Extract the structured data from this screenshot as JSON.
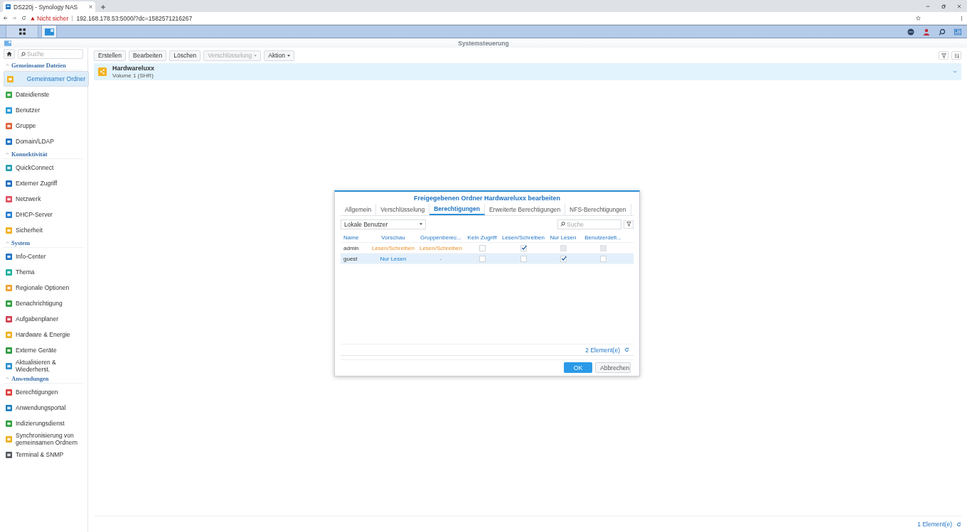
{
  "browser": {
    "tab_title": "DS220j - Synology NAS",
    "security": "Nicht sicher",
    "url": "192.168.178.53:5000/?dc=1582571216267"
  },
  "window": {
    "title": "Systemsteuerung"
  },
  "sidebar": {
    "search": {
      "placeholder": "Suche"
    },
    "sections": [
      {
        "title": "Gemeinsame Dateien",
        "items": [
          {
            "label": "Gemeinsamer Ordner",
            "selected": true
          },
          {
            "label": "Dateidienste",
            "selected": false
          },
          {
            "label": "Benutzer",
            "selected": false
          },
          {
            "label": "Gruppe",
            "selected": false
          },
          {
            "label": "Domain/LDAP",
            "selected": false
          }
        ]
      },
      {
        "title": "Konnektivität",
        "items": [
          {
            "label": "QuickConnect",
            "selected": false
          },
          {
            "label": "Externer Zugriff",
            "selected": false
          },
          {
            "label": "Netzwerk",
            "selected": false
          },
          {
            "label": "DHCP-Server",
            "selected": false
          },
          {
            "label": "Sicherheit",
            "selected": false
          }
        ]
      },
      {
        "title": "System",
        "items": [
          {
            "label": "Info-Center",
            "selected": false
          },
          {
            "label": "Thema",
            "selected": false
          },
          {
            "label": "Regionale Optionen",
            "selected": false
          },
          {
            "label": "Benachrichtigung",
            "selected": false
          },
          {
            "label": "Aufgabenplaner",
            "selected": false
          },
          {
            "label": "Hardware & Energie",
            "selected": false
          },
          {
            "label": "Externe Geräte",
            "selected": false
          },
          {
            "label": "Aktualisieren & Wiederherst.",
            "selected": false
          }
        ]
      },
      {
        "title": "Anwendungen",
        "items": [
          {
            "label": "Berechtigungen",
            "selected": false
          },
          {
            "label": "Anwendungsportal",
            "selected": false
          },
          {
            "label": "Indizierungsdienst",
            "selected": false
          },
          {
            "label": "Synchronisierung von gemeinsamen Ordnern",
            "selected": false
          },
          {
            "label": "Terminal & SNMP",
            "selected": false
          }
        ]
      }
    ]
  },
  "toolbar": [
    {
      "label": "Erstellen",
      "dropdown": false,
      "disabled": false
    },
    {
      "label": "Bearbeiten",
      "dropdown": false,
      "disabled": false
    },
    {
      "label": "Löschen",
      "dropdown": false,
      "disabled": false
    },
    {
      "label": "Verschlüsselung",
      "dropdown": true,
      "disabled": true
    },
    {
      "label": "Aktion",
      "dropdown": true,
      "disabled": false
    }
  ],
  "folders": [
    {
      "name": "Hardwareluxx",
      "volume": "Volume 1 (SHR)",
      "selected": true
    }
  ],
  "status": "1 Element(e)",
  "dialog": {
    "title": "Freigegebenen Ordner Hardwareluxx bearbeiten",
    "tabs": [
      {
        "label": "Allgemein",
        "selected": false
      },
      {
        "label": "Verschlüsselung",
        "selected": false
      },
      {
        "label": "Berechtigungen",
        "selected": true
      },
      {
        "label": "Erweiterte Berechtigungen",
        "selected": false
      },
      {
        "label": "NFS-Berechtigungen",
        "selected": false
      }
    ],
    "user_type": "Lokale Benutzer",
    "search": {
      "placeholder": "Suche"
    },
    "columns": [
      "Name",
      "Vorschau",
      "Gruppenberec...",
      "Kein Zugriff",
      "Lesen/Schreiben",
      "Nur Lesen",
      "Benutzerdefi..."
    ],
    "rows": [
      {
        "name": "admin",
        "preview": {
          "text": "Lesen/Schreiben",
          "kind": "write"
        },
        "group": {
          "text": "Lesen/Schreiben",
          "kind": "write"
        },
        "selected": false,
        "perms": [
          {
            "checked": false,
            "disabled": false
          },
          {
            "checked": true,
            "disabled": false
          },
          {
            "checked": false,
            "disabled": true
          },
          {
            "checked": false,
            "disabled": true
          }
        ]
      },
      {
        "name": "guest",
        "preview": {
          "text": "Nur Lesen",
          "kind": "read"
        },
        "group": {
          "text": "-",
          "kind": "none"
        },
        "selected": true,
        "perms": [
          {
            "checked": false,
            "disabled": false
          },
          {
            "checked": false,
            "disabled": false
          },
          {
            "checked": true,
            "disabled": false
          },
          {
            "checked": false,
            "disabled": false
          }
        ]
      }
    ],
    "count": "2 Element(e)",
    "buttons": [
      {
        "label": "OK",
        "kind": "primary"
      },
      {
        "label": "Abbrechen",
        "kind": "secondary"
      }
    ]
  }
}
